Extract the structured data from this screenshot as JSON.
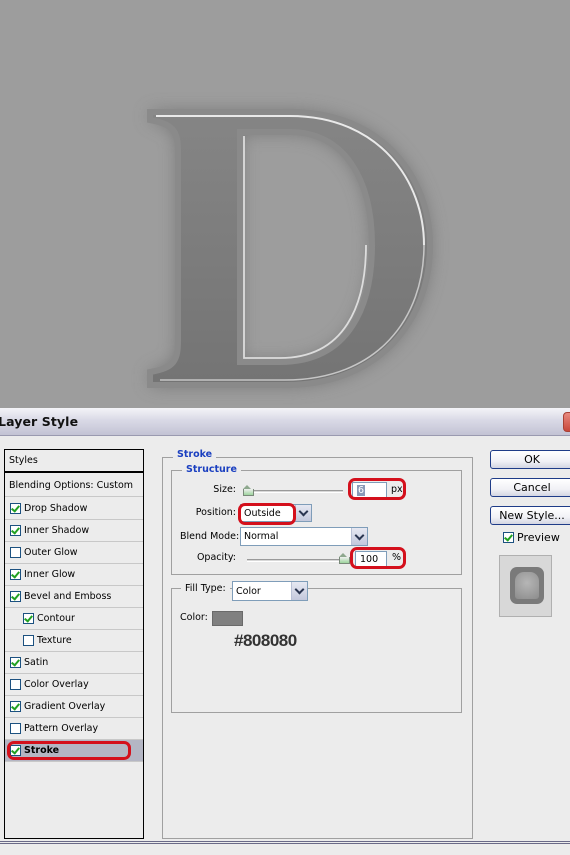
{
  "canvas": {
    "letter": "D",
    "background_color": "#9d9d9d",
    "letter_color": "#7b7b7b",
    "stroke_color": "#808080"
  },
  "dialog": {
    "title": "Layer Style",
    "styles_panel": {
      "header": "Styles",
      "blending_options": "Blending Options: Custom",
      "items": [
        {
          "label": "Drop Shadow",
          "checked": true,
          "indent": false,
          "selected": false
        },
        {
          "label": "Inner Shadow",
          "checked": true,
          "indent": false,
          "selected": false
        },
        {
          "label": "Outer Glow",
          "checked": false,
          "indent": false,
          "selected": false
        },
        {
          "label": "Inner Glow",
          "checked": true,
          "indent": false,
          "selected": false
        },
        {
          "label": "Bevel and Emboss",
          "checked": true,
          "indent": false,
          "selected": false
        },
        {
          "label": "Contour",
          "checked": true,
          "indent": true,
          "selected": false
        },
        {
          "label": "Texture",
          "checked": false,
          "indent": true,
          "selected": false
        },
        {
          "label": "Satin",
          "checked": true,
          "indent": false,
          "selected": false
        },
        {
          "label": "Color Overlay",
          "checked": false,
          "indent": false,
          "selected": false
        },
        {
          "label": "Gradient Overlay",
          "checked": true,
          "indent": false,
          "selected": false
        },
        {
          "label": "Pattern Overlay",
          "checked": false,
          "indent": false,
          "selected": false
        },
        {
          "label": "Stroke",
          "checked": true,
          "indent": false,
          "selected": true
        }
      ]
    },
    "stroke": {
      "group_title": "Stroke",
      "structure_title": "Structure",
      "size_label": "Size:",
      "size_value": "6",
      "size_unit": "px",
      "size_slider_fraction": 0.0,
      "position_label": "Position:",
      "position_value": "Outside",
      "blend_mode_label": "Blend Mode:",
      "blend_mode_value": "Normal",
      "opacity_label": "Opacity:",
      "opacity_value": "100",
      "opacity_unit": "%",
      "opacity_slider_fraction": 1.0,
      "fill_type_label": "Fill Type:",
      "fill_type_value": "Color",
      "color_label": "Color:",
      "color_value": "#808080",
      "color_annotation": "#808080"
    },
    "buttons": {
      "ok": "OK",
      "cancel": "Cancel",
      "new_style": "New Style..."
    },
    "preview": {
      "label": "Preview",
      "checked": true
    },
    "highlight_color": "#d4101c"
  }
}
